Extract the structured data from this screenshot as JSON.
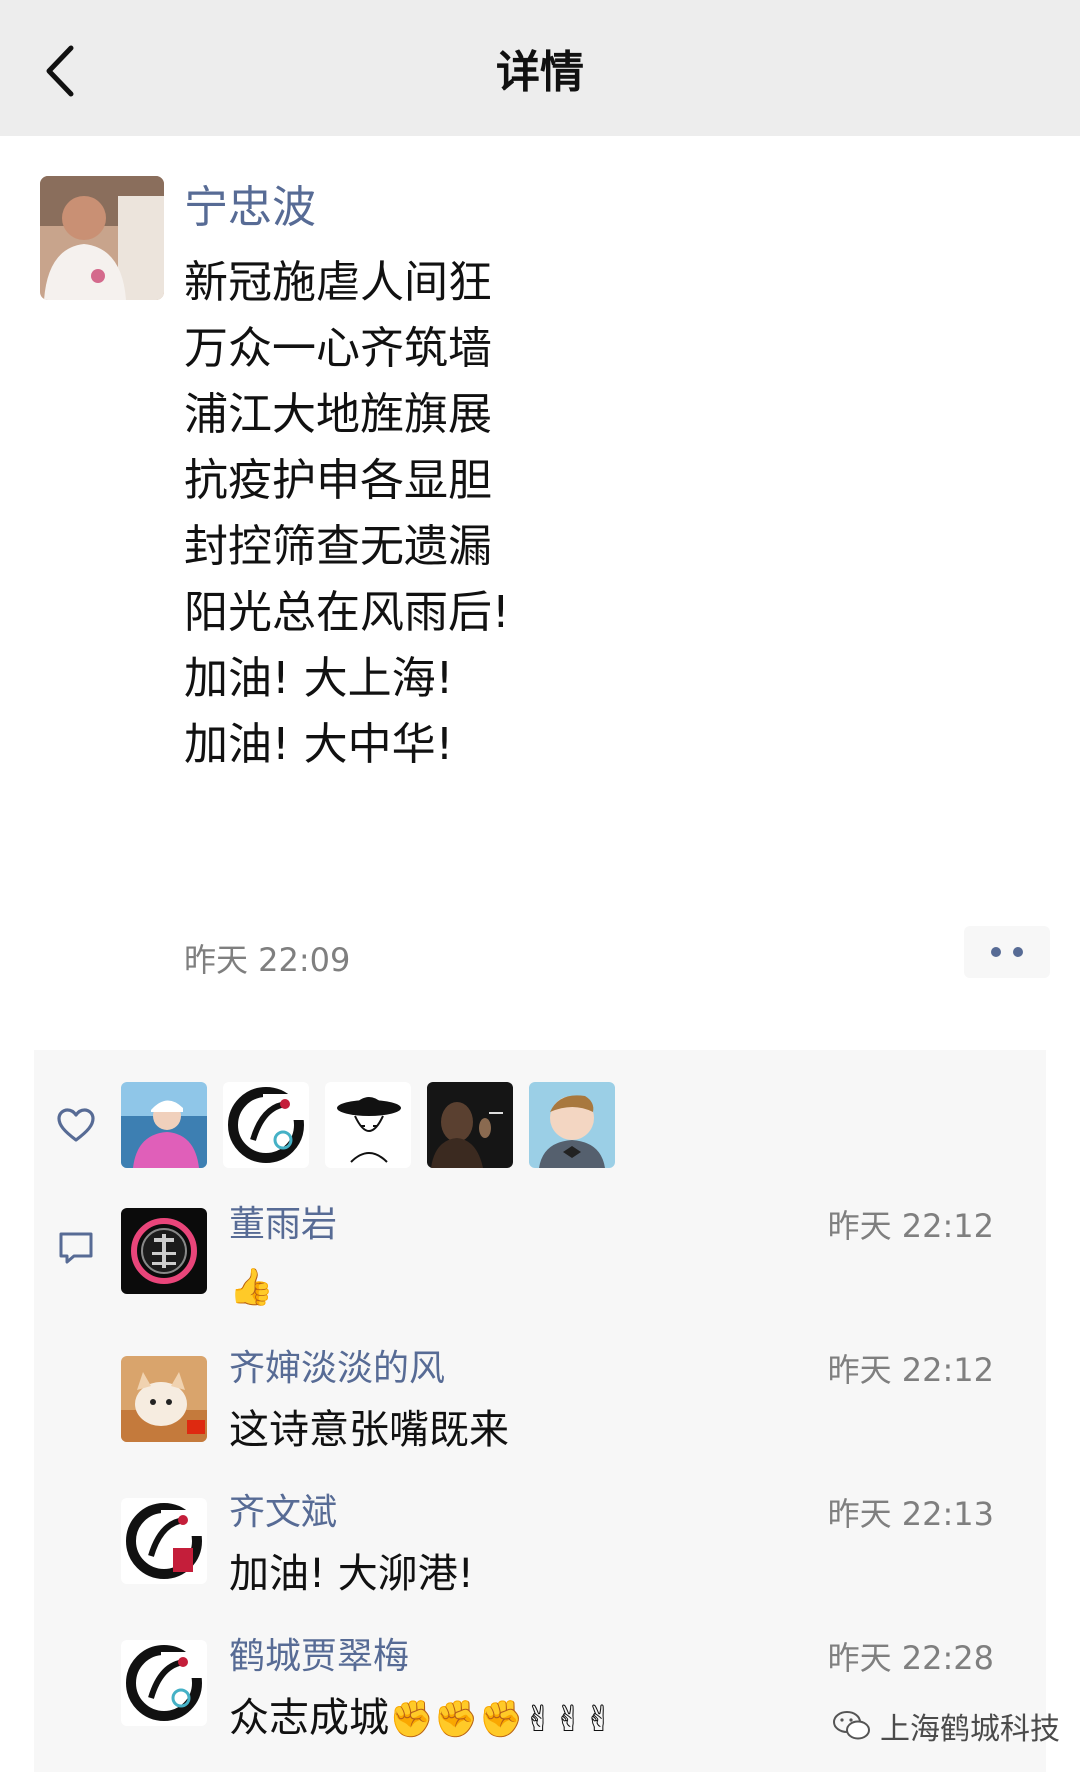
{
  "header": {
    "title": "详情",
    "back_icon": "chevron-left-icon"
  },
  "post": {
    "author": "宁忠波",
    "lines": [
      "新冠施虐人间狂",
      "万众一心齐筑墙",
      "浦江大地旌旗展",
      "抗疫护申各显胆",
      "封控筛查无遗漏",
      "阳光总在风雨后!",
      "加油! 大上海!",
      "加油! 大中华!"
    ],
    "time": "昨天 22:09",
    "more_icon": "more-dots-icon"
  },
  "likes": {
    "icon": "heart-icon",
    "count_avatars": 5
  },
  "comments_icon": "comment-icon",
  "comments": [
    {
      "name": "董雨岩",
      "time": "昨天 22:12",
      "text": "👍"
    },
    {
      "name": "齐婶淡淡的风",
      "time": "昨天 22:12",
      "text": "这诗意张嘴既来"
    },
    {
      "name": "齐文斌",
      "time": "昨天 22:13",
      "text": "加油! 大泖港!"
    },
    {
      "name": "鹤城贾翠梅",
      "time": "昨天 22:28",
      "text": "众志成城",
      "emojis": "✊✊✊✌✌✌"
    }
  ],
  "watermark": {
    "text": "上海鹤城科技",
    "icon": "wechat-icon"
  },
  "colors": {
    "name_blue": "#576b95",
    "header_bg": "#ededed",
    "panel_bg": "#f7f7f7"
  }
}
